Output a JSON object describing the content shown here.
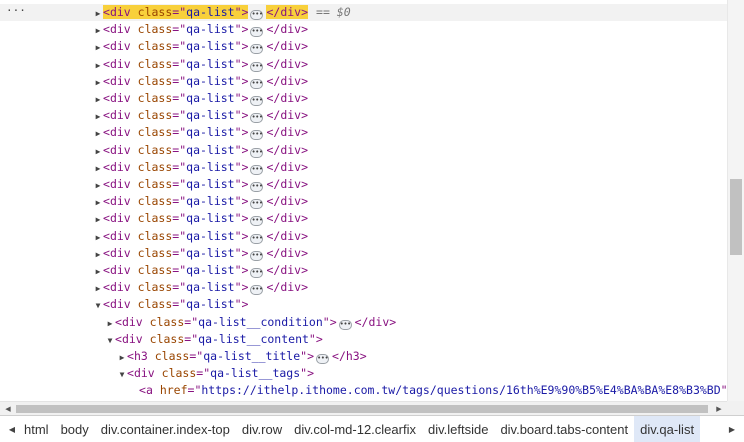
{
  "tree": {
    "eq_marker": "== $0",
    "rows": [
      {
        "indent": 93,
        "tri": "▶",
        "tag": "div",
        "attr": "class",
        "val": "qa-list",
        "ell": true,
        "close": "</div>",
        "selected": true
      },
      {
        "indent": 93,
        "tri": "▶",
        "tag": "div",
        "attr": "class",
        "val": "qa-list",
        "ell": true,
        "close": "</div>"
      },
      {
        "indent": 93,
        "tri": "▶",
        "tag": "div",
        "attr": "class",
        "val": "qa-list",
        "ell": true,
        "close": "</div>"
      },
      {
        "indent": 93,
        "tri": "▶",
        "tag": "div",
        "attr": "class",
        "val": "qa-list",
        "ell": true,
        "close": "</div>"
      },
      {
        "indent": 93,
        "tri": "▶",
        "tag": "div",
        "attr": "class",
        "val": "qa-list",
        "ell": true,
        "close": "</div>"
      },
      {
        "indent": 93,
        "tri": "▶",
        "tag": "div",
        "attr": "class",
        "val": "qa-list",
        "ell": true,
        "close": "</div>"
      },
      {
        "indent": 93,
        "tri": "▶",
        "tag": "div",
        "attr": "class",
        "val": "qa-list",
        "ell": true,
        "close": "</div>"
      },
      {
        "indent": 93,
        "tri": "▶",
        "tag": "div",
        "attr": "class",
        "val": "qa-list",
        "ell": true,
        "close": "</div>"
      },
      {
        "indent": 93,
        "tri": "▶",
        "tag": "div",
        "attr": "class",
        "val": "qa-list",
        "ell": true,
        "close": "</div>"
      },
      {
        "indent": 93,
        "tri": "▶",
        "tag": "div",
        "attr": "class",
        "val": "qa-list",
        "ell": true,
        "close": "</div>"
      },
      {
        "indent": 93,
        "tri": "▶",
        "tag": "div",
        "attr": "class",
        "val": "qa-list",
        "ell": true,
        "close": "</div>"
      },
      {
        "indent": 93,
        "tri": "▶",
        "tag": "div",
        "attr": "class",
        "val": "qa-list",
        "ell": true,
        "close": "</div>"
      },
      {
        "indent": 93,
        "tri": "▶",
        "tag": "div",
        "attr": "class",
        "val": "qa-list",
        "ell": true,
        "close": "</div>"
      },
      {
        "indent": 93,
        "tri": "▶",
        "tag": "div",
        "attr": "class",
        "val": "qa-list",
        "ell": true,
        "close": "</div>"
      },
      {
        "indent": 93,
        "tri": "▶",
        "tag": "div",
        "attr": "class",
        "val": "qa-list",
        "ell": true,
        "close": "</div>"
      },
      {
        "indent": 93,
        "tri": "▶",
        "tag": "div",
        "attr": "class",
        "val": "qa-list",
        "ell": true,
        "close": "</div>"
      },
      {
        "indent": 93,
        "tri": "▶",
        "tag": "div",
        "attr": "class",
        "val": "qa-list",
        "ell": true,
        "close": "</div>"
      },
      {
        "indent": 93,
        "tri": "▼",
        "tag": "div",
        "attr": "class",
        "val": "qa-list",
        "ell": false,
        "close": ""
      },
      {
        "indent": 105,
        "tri": "▶",
        "tag": "div",
        "attr": "class",
        "val": "qa-list__condition",
        "ell": true,
        "close": "</div>"
      },
      {
        "indent": 105,
        "tri": "▼",
        "tag": "div",
        "attr": "class",
        "val": "qa-list__content",
        "ell": false,
        "close": ""
      },
      {
        "indent": 117,
        "tri": "▶",
        "tag": "h3",
        "attr": "class",
        "val": "qa-list__title",
        "ell": true,
        "close": "</h3>"
      },
      {
        "indent": 117,
        "tri": "▼",
        "tag": "div",
        "attr": "class",
        "val": "qa-list__tags",
        "ell": false,
        "close": ""
      },
      {
        "indent": 129,
        "tri": "",
        "tag": "a",
        "attr": "href",
        "val": "https://ithelp.ithome.com.tw/tags/questions/16th%E9%90%B5%E4%BA%BA%E8%B3%BD",
        "ell": false,
        "close": ""
      }
    ]
  },
  "breadcrumbs": [
    {
      "label": "html"
    },
    {
      "label": "body"
    },
    {
      "label": "div.container.index-top"
    },
    {
      "label": "div.row"
    },
    {
      "label": "div.col-md-12.clearfix"
    },
    {
      "label": "div.leftside"
    },
    {
      "label": "div.board.tabs-content"
    },
    {
      "label": "div.qa-list",
      "active": true
    }
  ],
  "icons": {
    "row_menu": "more-dots-icon",
    "collapse": "triangle-right-icon",
    "expand": "triangle-down-icon",
    "crumb_left": "chevron-left-icon",
    "crumb_right": "chevron-right-icon"
  },
  "colors": {
    "tag": "#881280",
    "attr_name": "#994500",
    "attr_value": "#1a1aa6",
    "selection_highlight": "#f8d03b",
    "active_crumb": "#dfe8f7"
  }
}
